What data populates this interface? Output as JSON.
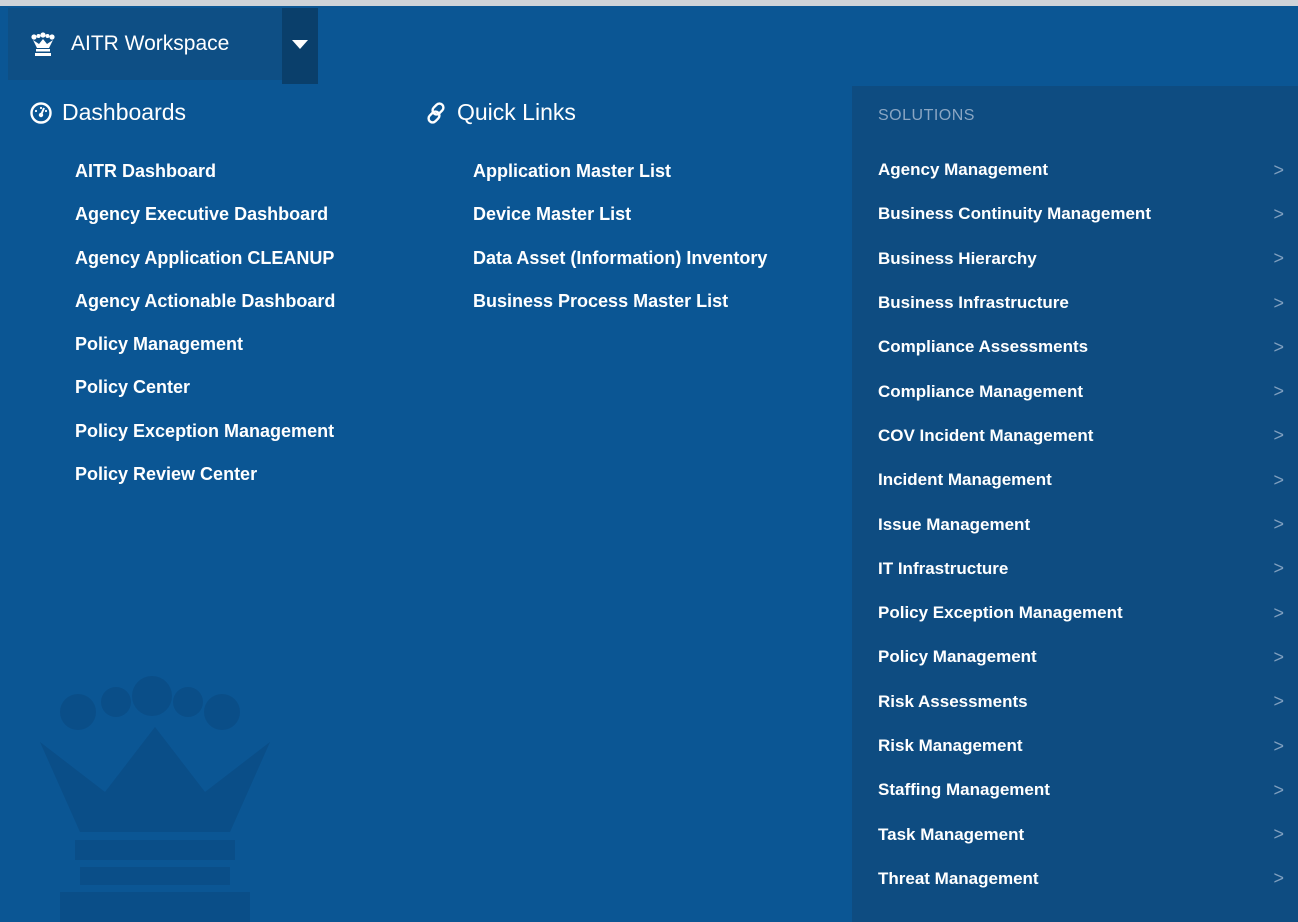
{
  "header": {
    "workspace_label": "AITR Workspace",
    "crown_icon": "crown-icon",
    "dropdown_icon": "caret-down-icon"
  },
  "dashboards": {
    "heading": "Dashboards",
    "icon": "dashboard-gauge-icon",
    "items": [
      "AITR Dashboard",
      "Agency Executive Dashboard",
      "Agency Application CLEANUP",
      "Agency Actionable Dashboard",
      "Policy Management",
      "Policy Center",
      "Policy Exception Management",
      "Policy Review Center"
    ]
  },
  "quick_links": {
    "heading": "Quick Links",
    "icon": "link-icon",
    "items": [
      "Application Master List",
      "Device Master List",
      "Data Asset (Information) Inventory",
      "Business Process Master List"
    ]
  },
  "solutions": {
    "heading": "SOLUTIONS",
    "chevron": ">",
    "items": [
      "Agency Management",
      "Business Continuity Management",
      "Business Hierarchy",
      "Business Infrastructure",
      "Compliance Assessments",
      "Compliance Management",
      "COV Incident Management",
      "Incident Management",
      "Issue Management",
      "IT Infrastructure",
      "Policy Exception Management",
      "Policy Management",
      "Risk Assessments",
      "Risk Management",
      "Staffing Management",
      "Task Management",
      "Threat Management"
    ]
  },
  "colors": {
    "background": "#0b5694",
    "solutions_panel": "#0e4c81",
    "workspace_button": "#0e4f85",
    "caret_button": "#0a3f6b",
    "muted_text": "#8aa6c3"
  }
}
